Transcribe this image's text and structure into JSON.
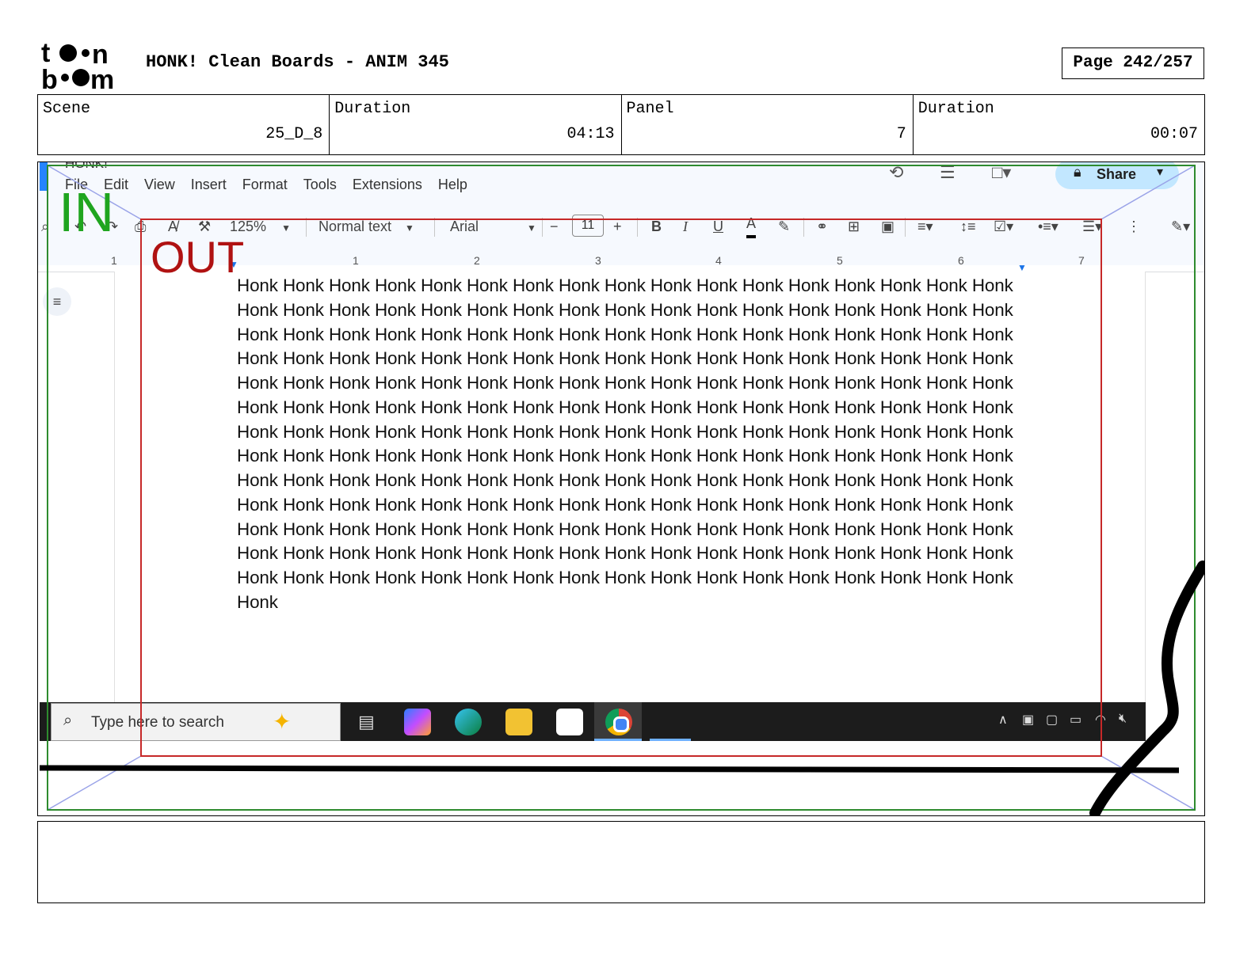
{
  "header": {
    "title": "HONK! Clean Boards - ANIM 345",
    "page": "Page 242/257",
    "logo_text": "toon boom"
  },
  "info": {
    "scene_label": "Scene",
    "scene_value": "25_D_8",
    "duration_label": "Duration",
    "duration_value": "04:13",
    "panel_label": "Panel",
    "panel_value": "7",
    "panel_duration_label": "Duration",
    "panel_duration_value": "00:07"
  },
  "gdocs": {
    "doc_title": "HONK!",
    "menu": [
      "File",
      "Edit",
      "View",
      "Insert",
      "Format",
      "Tools",
      "Extensions",
      "Help"
    ],
    "share_label": "Share",
    "zoom": "125%",
    "style": "Normal text",
    "font": "Arial",
    "font_size": "11",
    "ruler_numbers": [
      "1",
      "1",
      "2",
      "3",
      "4",
      "5",
      "6",
      "7"
    ],
    "body_text": "Honk Honk Honk Honk Honk Honk Honk Honk Honk Honk Honk Honk Honk Honk Honk Honk Honk Honk Honk Honk Honk Honk Honk Honk Honk Honk Honk Honk Honk Honk Honk Honk Honk Honk Honk Honk Honk Honk Honk Honk Honk Honk Honk Honk Honk Honk Honk Honk Honk Honk Honk Honk Honk Honk Honk Honk Honk Honk Honk Honk Honk Honk Honk Honk Honk Honk Honk Honk Honk Honk Honk Honk Honk Honk Honk Honk Honk Honk Honk Honk Honk Honk Honk Honk Honk Honk Honk Honk Honk Honk Honk Honk Honk Honk Honk Honk Honk Honk Honk Honk Honk Honk Honk Honk Honk Honk Honk Honk Honk Honk Honk Honk Honk Honk Honk Honk Honk Honk Honk Honk Honk Honk Honk Honk Honk Honk Honk Honk Honk Honk Honk Honk Honk Honk Honk Honk Honk Honk Honk Honk Honk Honk Honk Honk Honk Honk Honk Honk Honk Honk Honk Honk Honk Honk Honk Honk Honk Honk Honk Honk Honk Honk Honk Honk Honk Honk Honk Honk Honk Honk Honk Honk Honk Honk Honk Honk Honk Honk Honk Honk Honk Honk Honk Honk Honk Honk Honk Honk Honk Honk Honk Honk Honk Honk Honk Honk Honk Honk Honk Honk Honk Honk Honk Honk Honk Honk Honk Honk Honk Honk Honk Honk Honk Honk Honk Honk Honk Honk Honk Honk Honk Honk"
  },
  "taskbar": {
    "search_placeholder": "Type here to search"
  },
  "annotations": {
    "in_label": "IN",
    "out_label": "OUT",
    "in_color": "#1fa51f",
    "out_color": "#b01212"
  }
}
